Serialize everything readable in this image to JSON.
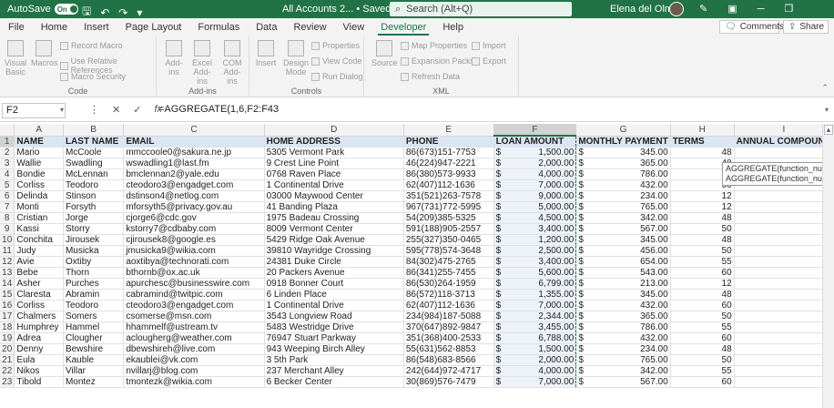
{
  "titlebar": {
    "autosave_label": "AutoSave",
    "autosave_state": "On",
    "doc_title": "All Accounts 2... • Saved",
    "search_placeholder": "Search (Alt+Q)",
    "user_name": "Elena del Olmo"
  },
  "menu": {
    "tabs": [
      "File",
      "Home",
      "Insert",
      "Page Layout",
      "Formulas",
      "Data",
      "Review",
      "View",
      "Developer",
      "Help"
    ],
    "active": "Developer",
    "comments_label": "Comments",
    "share_label": "Share"
  },
  "ribbon": {
    "code": {
      "label": "Code",
      "visual_basic": "Visual Basic",
      "macros": "Macros",
      "record_macro": "Record Macro",
      "relative_refs": "Use Relative References",
      "macro_security": "Macro Security"
    },
    "addins": {
      "label": "Add-ins",
      "addins": "Add-ins",
      "excel_addins": "Excel Add-ins",
      "com_addins": "COM Add-ins"
    },
    "controls": {
      "label": "Controls",
      "insert": "Insert",
      "design_mode": "Design Mode",
      "properties": "Properties",
      "view_code": "View Code",
      "run_dialog": "Run Dialog"
    },
    "xml": {
      "label": "XML",
      "source": "Source",
      "map_properties": "Map Properties",
      "expansion_packs": "Expansion Packs",
      "refresh_data": "Refresh Data",
      "import": "Import",
      "export": "Export"
    }
  },
  "formula_bar": {
    "cell": "F2",
    "formula": "=AGGREGATE(1,6,F2:F43"
  },
  "tooltip": {
    "line1": "AGGREGATE(function_num, options, ref1, ...)",
    "line2": "AGGREGATE(function_num, options, array, [k])"
  },
  "sheet": {
    "columns": [
      "A",
      "B",
      "C",
      "D",
      "E",
      "F",
      "G",
      "H",
      "I"
    ],
    "headers": [
      "NAME",
      "LAST NAME",
      "EMAIL",
      "HOME ADDRESS",
      "PHONE",
      "LOAN AMOUNT",
      "MONTHLY PAYMENT",
      "TERMS",
      "ANNUAL COMPOUND"
    ],
    "rows": [
      [
        "Mario",
        "McCoole",
        "mmccoole0@sakura.ne.jp",
        "5305 Vermont Park",
        "86(673)151-7753",
        "1,500.00",
        "345.00",
        "48"
      ],
      [
        "Wallie",
        "Swadling",
        "wswadling1@last.fm",
        "9 Crest Line Point",
        "46(224)947-2221",
        "2,000.00",
        "365.00",
        "48"
      ],
      [
        "Bondie",
        "McLennan",
        "bmclennan2@yale.edu",
        "0768 Raven Place",
        "86(380)573-9933",
        "4,000.00",
        "786.00",
        "36"
      ],
      [
        "Corliss",
        "Teodoro",
        "cteodoro3@engadget.com",
        "1 Continental Drive",
        "62(407)112-1636",
        "7,000.00",
        "432.00",
        "60"
      ],
      [
        "Delinda",
        "Stinson",
        "dstinson4@netlog.com",
        "03000 Maywood Center",
        "351(521)263-7578",
        "9,000.00",
        "234.00",
        "12"
      ],
      [
        "Monti",
        "Forsyth",
        "mforsyth5@privacy.gov.au",
        "41 Banding Plaza",
        "967(731)772-5995",
        "5,000.00",
        "765.00",
        "12"
      ],
      [
        "Cristian",
        "Jorge",
        "cjorge6@cdc.gov",
        "1975 Badeau Crossing",
        "54(209)385-5325",
        "4,500.00",
        "342.00",
        "48"
      ],
      [
        "Kassi",
        "Storry",
        "kstorry7@cdbaby.com",
        "8009 Vermont Center",
        "591(188)905-2557",
        "3,400.00",
        "567.00",
        "50"
      ],
      [
        "Conchita",
        "Jirousek",
        "cjirousek8@google.es",
        "5429 Ridge Oak Avenue",
        "255(327)350-0465",
        "1,200.00",
        "345.00",
        "48"
      ],
      [
        "Judy",
        "Musicka",
        "jmusicka9@wikia.com",
        "39810 Wayridge Crossing",
        "595(778)574-3648",
        "2,500.00",
        "456.00",
        "50"
      ],
      [
        "Avie",
        "Oxtiby",
        "aoxtibya@technorati.com",
        "24381 Duke Circle",
        "84(302)475-2765",
        "3,400.00",
        "654.00",
        "55"
      ],
      [
        "Bebe",
        "Thorn",
        "bthornb@ox.ac.uk",
        "20 Packers Avenue",
        "86(341)255-7455",
        "5,600.00",
        "543.00",
        "60"
      ],
      [
        "Asher",
        "Purches",
        "apurchesc@businesswire.com",
        "0918 Bonner Court",
        "86(530)264-1959",
        "6,799.00",
        "213.00",
        "12"
      ],
      [
        "Claresta",
        "Abramin",
        "cabramind@twitpic.com",
        "6 Linden Place",
        "86(572)118-3713",
        "1,355.00",
        "345.00",
        "48"
      ],
      [
        "Corliss",
        "Teodoro",
        "cteodoro3@engadget.com",
        "1 Continental Drive",
        "62(407)112-1636",
        "7,000.00",
        "432.00",
        "60"
      ],
      [
        "Chalmers",
        "Somers",
        "csomerse@msn.com",
        "3543 Longview Road",
        "234(984)187-5088",
        "2,344.00",
        "365.00",
        "50"
      ],
      [
        "Humphrey",
        "Hammel",
        "hhammelf@ustream.tv",
        "5483 Westridge Drive",
        "370(647)892-9847",
        "3,455.00",
        "786.00",
        "55"
      ],
      [
        "Adrea",
        "Clougher",
        "aclougherg@weather.com",
        "76947 Stuart Parkway",
        "351(368)400-2533",
        "6,788.00",
        "432.00",
        "60"
      ],
      [
        "Denny",
        "Bewshire",
        "dbewshireh@live.com",
        "943 Weeping Birch Alley",
        "55(631)562-8853",
        "1,500.00",
        "234.00",
        "48"
      ],
      [
        "Eula",
        "Kauble",
        "ekaublei@vk.com",
        "3 5th Park",
        "86(548)683-8566",
        "2,000.00",
        "765.00",
        "50"
      ],
      [
        "Nikos",
        "Villar",
        "nvillarj@blog.com",
        "237 Merchant Alley",
        "242(644)972-4717",
        "4,000.00",
        "342.00",
        "55"
      ],
      [
        "Tibold",
        "Montez",
        "tmontezk@wikia.com",
        "6 Becker Center",
        "30(869)576-7479",
        "7,000.00",
        "567.00",
        "60"
      ]
    ]
  }
}
